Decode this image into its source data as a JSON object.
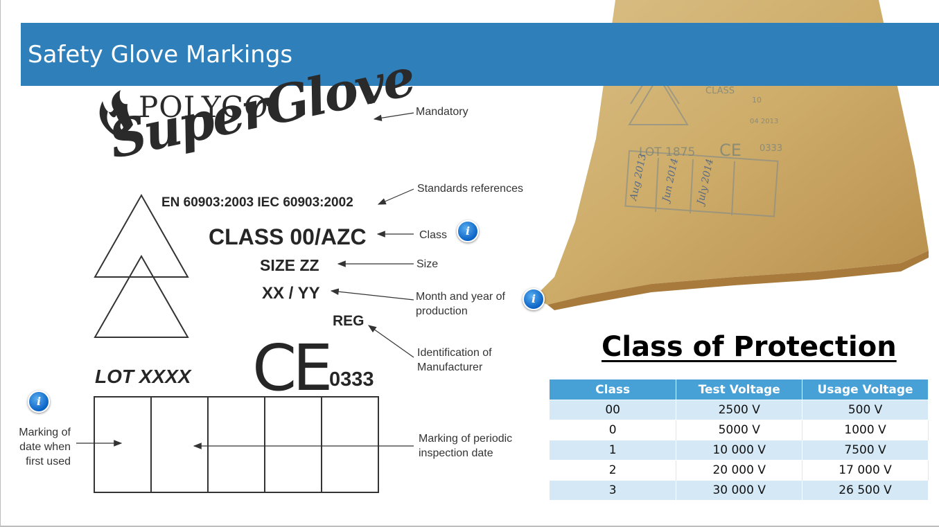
{
  "title": "Safety Glove Markings",
  "logo": {
    "line1": "POLYCO",
    "line2": "SuperGlove",
    "reg": "®"
  },
  "markings": {
    "standards": "EN 60903:2003 IEC 60903:2002",
    "class": "CLASS 00/AZC",
    "size": "SIZE ZZ",
    "date": "XX / YY",
    "reg": "REG",
    "lot": "LOT XXXX",
    "ce": "CE",
    "ce_number": "0333"
  },
  "labels": {
    "mandatory": "Mandatory",
    "standards": "Standards references",
    "class": "Class",
    "size": "Size",
    "month_year": [
      "Month and year of",
      "production"
    ],
    "manufacturer": [
      "Identification of",
      "Manufacturer"
    ],
    "first_used": [
      "Marking of",
      "date when",
      "first used"
    ],
    "periodic": [
      "Marking of periodic",
      "inspection date"
    ]
  },
  "photo": {
    "class_text": "CLASS",
    "lot_text": "LOT 1875",
    "ce_text": "CE",
    "ce_number": "0333",
    "size_text": "10",
    "small_text": "04 2013",
    "dates": [
      "Aug 2013",
      "Jun 2014",
      "July 2014"
    ]
  },
  "protection": {
    "title": "Class of Protection",
    "headers": [
      "Class",
      "Test Voltage",
      "Usage Voltage"
    ],
    "rows": [
      [
        "00",
        "2500 V",
        "500 V"
      ],
      [
        "0",
        "5000 V",
        "1000 V"
      ],
      [
        "1",
        "10 000 V",
        "7500 V"
      ],
      [
        "2",
        "20 000 V",
        "17 000 V"
      ],
      [
        "3",
        "30 000 V",
        "26 500 V"
      ]
    ]
  },
  "colors": {
    "title_bar": "#2f7fba",
    "table_header": "#47a0d6",
    "table_stripe": "#d4e8f6",
    "info_icon": "#1a73d6"
  }
}
